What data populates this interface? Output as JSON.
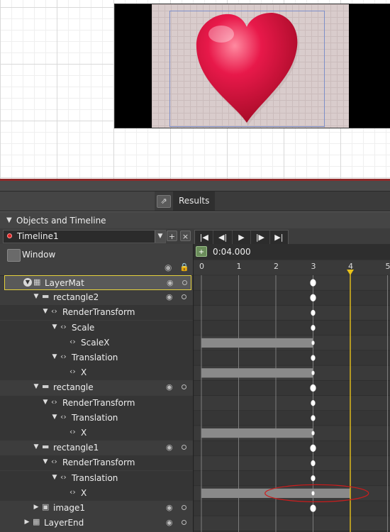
{
  "results_tab": {
    "label": "Results",
    "popout_icon": "popout-icon"
  },
  "objects_panel": {
    "title": "Objects and Timeline"
  },
  "timeline": {
    "name": "Timeline1",
    "add_label": "+",
    "close_label": "×",
    "transport": [
      "|◀",
      "◀|",
      "▶",
      "|▶",
      "▶|"
    ],
    "timecode": "0:04.000",
    "ruler_ticks": [
      "0",
      "1",
      "2",
      "3",
      "4",
      "5"
    ]
  },
  "window_label": "Window",
  "tree": [
    {
      "label": "LayerMat",
      "indent": 0,
      "expander": "circle",
      "icon": "grid-icon",
      "selected": true,
      "eye": true
    },
    {
      "label": "rectangle2",
      "indent": 1,
      "expander": "down",
      "icon": "rect-icon",
      "eye": true
    },
    {
      "label": "RenderTransform",
      "indent": 2,
      "expander": "down",
      "icon": "property-icon",
      "sub": true
    },
    {
      "label": "Scale",
      "indent": 3,
      "expander": "down",
      "icon": "property-icon",
      "sub": true
    },
    {
      "label": "ScaleX",
      "indent": 4,
      "expander": "none",
      "icon": "property-icon",
      "sub": true
    },
    {
      "label": "Translation",
      "indent": 3,
      "expander": "down",
      "icon": "property-icon",
      "sub": true
    },
    {
      "label": "X",
      "indent": 4,
      "expander": "none",
      "icon": "property-icon",
      "sub": true
    },
    {
      "label": "rectangle",
      "indent": 1,
      "expander": "down",
      "icon": "rect-icon",
      "eye": true
    },
    {
      "label": "RenderTransform",
      "indent": 2,
      "expander": "down",
      "icon": "property-icon",
      "sub": true
    },
    {
      "label": "Translation",
      "indent": 3,
      "expander": "down",
      "icon": "property-icon",
      "sub": true
    },
    {
      "label": "X",
      "indent": 4,
      "expander": "none",
      "icon": "property-icon",
      "sub": true
    },
    {
      "label": "rectangle1",
      "indent": 1,
      "expander": "down",
      "icon": "rect-icon",
      "eye": true
    },
    {
      "label": "RenderTransform",
      "indent": 2,
      "expander": "down",
      "icon": "property-icon",
      "sub": true
    },
    {
      "label": "Translation",
      "indent": 3,
      "expander": "down",
      "icon": "property-icon",
      "sub": true
    },
    {
      "label": "X",
      "indent": 4,
      "expander": "none",
      "icon": "property-icon",
      "sub": true
    },
    {
      "label": "image1",
      "indent": 1,
      "expander": "right",
      "icon": "image-icon",
      "eye": true
    },
    {
      "label": "LayerEnd",
      "indent": 0,
      "expander": "right",
      "icon": "grid-icon",
      "eye": true
    }
  ],
  "keyframes": {
    "time_marker": 4,
    "key_rows": [
      0,
      1,
      2,
      3,
      4,
      5,
      6,
      7,
      8,
      9,
      10,
      11,
      12,
      13,
      14,
      15
    ],
    "key_time": 3,
    "bars": [
      {
        "row": 4,
        "start": 0,
        "end": 3
      },
      {
        "row": 6,
        "start": 0,
        "end": 3
      },
      {
        "row": 10,
        "start": 0,
        "end": 3
      },
      {
        "row": 14,
        "start": 0,
        "end": 4
      }
    ],
    "highlight_row": 14
  },
  "colors": {
    "heart": "#e0163f",
    "marker": "#e8c21a",
    "annotation": "#cc1d1d"
  }
}
